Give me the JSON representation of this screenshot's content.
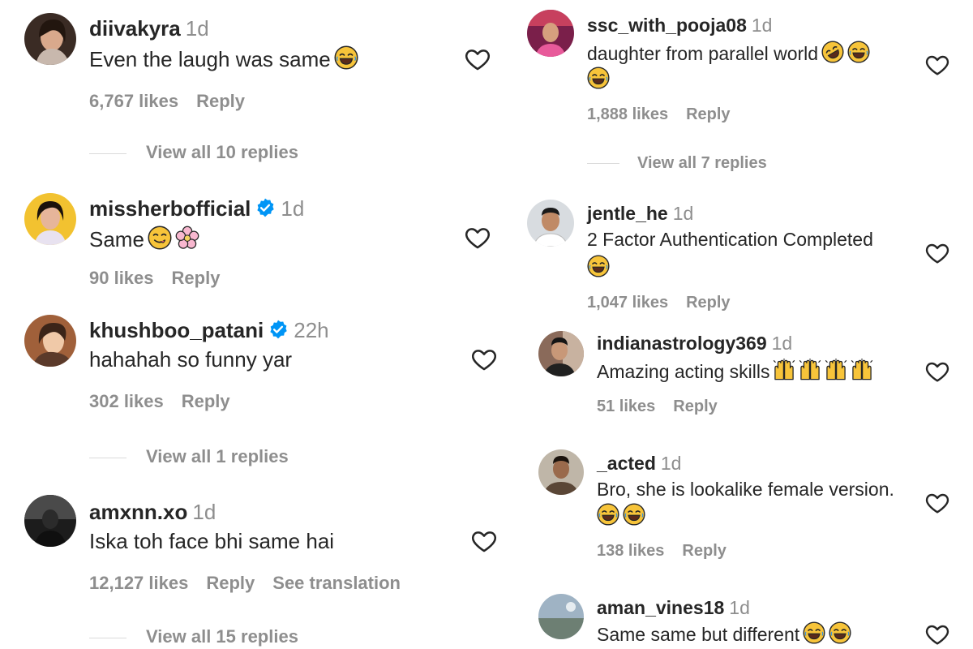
{
  "left_comments": [
    {
      "username": "diivakyra",
      "time": "1d",
      "text": "Even the laugh was same",
      "emojis": [
        "joy"
      ],
      "likes": "6,767 likes",
      "reply": "Reply",
      "view_replies": "View all 10 replies"
    },
    {
      "username": "missherbofficial",
      "verified": true,
      "time": "1d",
      "text": "Same",
      "emojis": [
        "yum",
        "blossom"
      ],
      "likes": "90 likes",
      "reply": "Reply"
    },
    {
      "username": "khushboo_patani",
      "verified": true,
      "time": "22h",
      "text": "hahahah so funny yar",
      "likes": "302 likes",
      "reply": "Reply",
      "view_replies": "View all 1 replies"
    },
    {
      "username": "amxnn.xo",
      "time": "1d",
      "text": "Iska toh face bhi same hai",
      "likes": "12,127 likes",
      "reply": "Reply",
      "translation": "See translation",
      "view_replies": "View all 15 replies"
    }
  ],
  "right_comments": [
    {
      "username": "ssc_with_pooja08",
      "time": "1d",
      "text": "daughter from parallel world",
      "emojis": [
        "rofl",
        "joy",
        "joy"
      ],
      "likes": "1,888 likes",
      "reply": "Reply",
      "view_replies": "View all 7 replies"
    },
    {
      "username": "jentle_he",
      "time": "1d",
      "text": "2 Factor Authentication Completed",
      "emojis": [
        "joy"
      ],
      "likes": "1,047 likes",
      "reply": "Reply"
    },
    {
      "username": "indianastrology369",
      "time": "1d",
      "text": "Amazing acting skills",
      "emojis": [
        "raised-hands",
        "raised-hands",
        "raised-hands",
        "raised-hands"
      ],
      "likes": "51 likes",
      "reply": "Reply"
    },
    {
      "username": "_acted",
      "time": "1d",
      "text": "Bro, she is lookalike female version.",
      "emojis": [
        "joy",
        "joy"
      ],
      "likes": "138 likes",
      "reply": "Reply"
    },
    {
      "username": "aman_vines18",
      "time": "1d",
      "text": "Same same but different",
      "emojis": [
        "joy",
        "joy"
      ]
    }
  ],
  "icons": {
    "like": "heart-icon",
    "verified": "verified-badge-icon"
  },
  "colors": {
    "text": "#262626",
    "secondary": "#8e8e8e",
    "verified": "#0095f6",
    "emoji": "#f7c43a"
  }
}
